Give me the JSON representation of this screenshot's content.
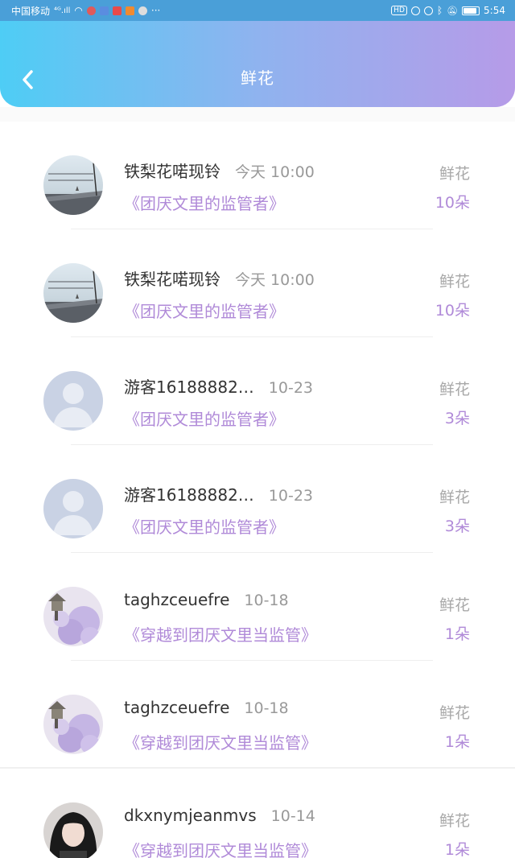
{
  "status_bar": {
    "carrier": "中国移动",
    "signal": "⁴ᴳ.ıll",
    "dots": "···",
    "hd": "HD",
    "time": "5:54"
  },
  "header": {
    "title": "鲜花"
  },
  "colors": {
    "header_gradient_start": "#4ecdf5",
    "header_gradient_end": "#b69be8",
    "accent_purple": "#b08ad8",
    "muted_gray": "#999999"
  },
  "list": {
    "items": [
      {
        "name": "铁梨花喏现铃",
        "time": "今天 10:00",
        "book": "《团厌文里的监管者》",
        "gift": "鲜花",
        "count": "10朵",
        "avatar": "landscape"
      },
      {
        "name": "铁梨花喏现铃",
        "time": "今天 10:00",
        "book": "《团厌文里的监管者》",
        "gift": "鲜花",
        "count": "10朵",
        "avatar": "landscape"
      },
      {
        "name": "游客16188882…",
        "time": "10-23",
        "book": "《团厌文里的监管者》",
        "gift": "鲜花",
        "count": "3朵",
        "avatar": "default-user"
      },
      {
        "name": "游客16188882…",
        "time": "10-23",
        "book": "《团厌文里的监管者》",
        "gift": "鲜花",
        "count": "3朵",
        "avatar": "default-user"
      },
      {
        "name": "taghzceuefre",
        "time": "10-18",
        "book": "《穿越到团厌文里当监管》",
        "gift": "鲜花",
        "count": "1朵",
        "avatar": "purple-flowers"
      },
      {
        "name": "taghzceuefre",
        "time": "10-18",
        "book": "《穿越到团厌文里当监管》",
        "gift": "鲜花",
        "count": "1朵",
        "avatar": "purple-flowers"
      },
      {
        "name": "dkxnymjeanmvs",
        "time": "10-14",
        "book": "《穿越到团厌文里当监管》",
        "gift": "鲜花",
        "count": "1朵",
        "avatar": "portrait"
      }
    ]
  }
}
